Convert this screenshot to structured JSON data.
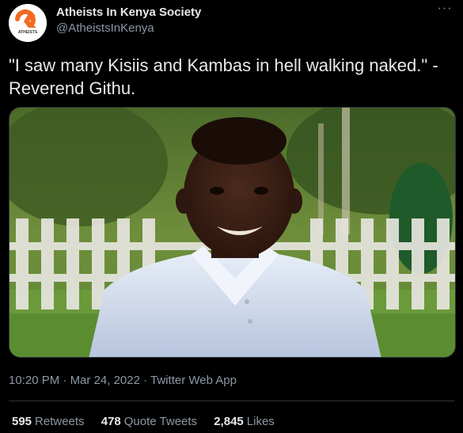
{
  "account": {
    "name": "Atheists In Kenya Society",
    "handle": "@AtheistsInKenya",
    "avatar_text": "ATHEISTS"
  },
  "tweet": {
    "text": "\"I saw many Kisiis and Kambas in hell walking naked.\" - Reverend Githu.",
    "time": "10:20 PM",
    "date": "Mar 24, 2022",
    "source": "Twitter Web App",
    "separator": "·"
  },
  "stats": {
    "retweets_count": "595",
    "retweets_label": "Retweets",
    "quote_count": "478",
    "quote_label": "Quote Tweets",
    "likes_count": "2,845",
    "likes_label": "Likes"
  },
  "colors": {
    "background": "#000000",
    "primary_text": "#e7e9ea",
    "secondary_text": "#8b98a5",
    "divider": "#2f3336",
    "avatar_orange": "#f26b21"
  },
  "icons": {
    "more": "more-horizontal-icon"
  }
}
